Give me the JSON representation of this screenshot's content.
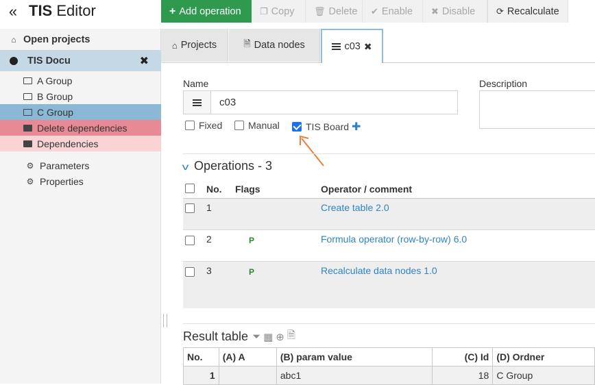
{
  "header": {
    "collapse_icon": "«",
    "app_name_bold": "TIS",
    "app_name_rest": " Editor"
  },
  "toolbar": {
    "add_operation": "Add operation",
    "copy": "Copy",
    "delete": "Delete",
    "enable": "Enable",
    "disable": "Disable",
    "recalculate": "Recalculate"
  },
  "sidebar": {
    "open_projects": "Open projects",
    "project": "TIS Docu",
    "groups": [
      "A Group",
      "B Group",
      "C Group"
    ],
    "delete_dependencies": "Delete dependencies",
    "dependencies": "Dependencies",
    "parameters": "Parameters",
    "properties": "Properties"
  },
  "tabs": {
    "projects": "Projects",
    "data_nodes": "Data nodes",
    "active": "c03"
  },
  "form": {
    "name_label": "Name",
    "name_value": "c03",
    "description_label": "Description",
    "fixed_label": "Fixed",
    "manual_label": "Manual",
    "tis_board_label": "TIS Board",
    "fixed_checked": false,
    "manual_checked": false,
    "tis_board_checked": true
  },
  "operations": {
    "title": "Operations - 3",
    "headers": {
      "no": "No.",
      "flags": "Flags",
      "operator": "Operator / comment"
    },
    "rows": [
      {
        "no": "1",
        "flag": "",
        "operator": "Create table 2.0"
      },
      {
        "no": "2",
        "flag": "P",
        "operator": "Formula operator (row-by-row) 6.0"
      },
      {
        "no": "3",
        "flag": "P",
        "operator": "Recalculate data nodes 1.0"
      }
    ]
  },
  "result": {
    "title": "Result table",
    "headers": [
      "No.",
      "(A) A",
      "(B) param value",
      "(C) Id",
      "(D) Ordner"
    ],
    "rows": [
      [
        "1",
        "",
        "abc1",
        "18",
        "C Group"
      ]
    ]
  },
  "colors": {
    "primary_green": "#2f9a4e",
    "selected_blue": "#8bb8d4",
    "project_blue": "#c4d8e6",
    "delete_red": "#e88a95",
    "dependency_pink": "#fad4d4",
    "link_blue": "#2f83c4",
    "annotation_arrow": "#e8803a"
  }
}
